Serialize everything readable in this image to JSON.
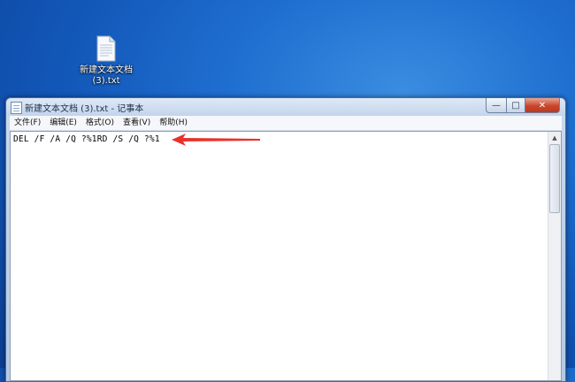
{
  "desktop": {
    "icon": {
      "name": "file-icon",
      "label_line1": "新建文本文档",
      "label_line2": "(3).txt"
    }
  },
  "window": {
    "title": "新建文本文档 (3).txt - 记事本",
    "controls": {
      "minimize": "—",
      "maximize": "□",
      "close": "✕"
    },
    "menu": [
      {
        "label": "文件(F)"
      },
      {
        "label": "编辑(E)"
      },
      {
        "label": "格式(O)"
      },
      {
        "label": "查看(V)"
      },
      {
        "label": "帮助(H)"
      }
    ],
    "editor": {
      "content": "DEL /F /A /Q ?%1RD /S /Q ?%1"
    },
    "scrollbar": {
      "up_arrow": "▲"
    }
  },
  "annotation": {
    "arrow_color": "#e8322a"
  }
}
